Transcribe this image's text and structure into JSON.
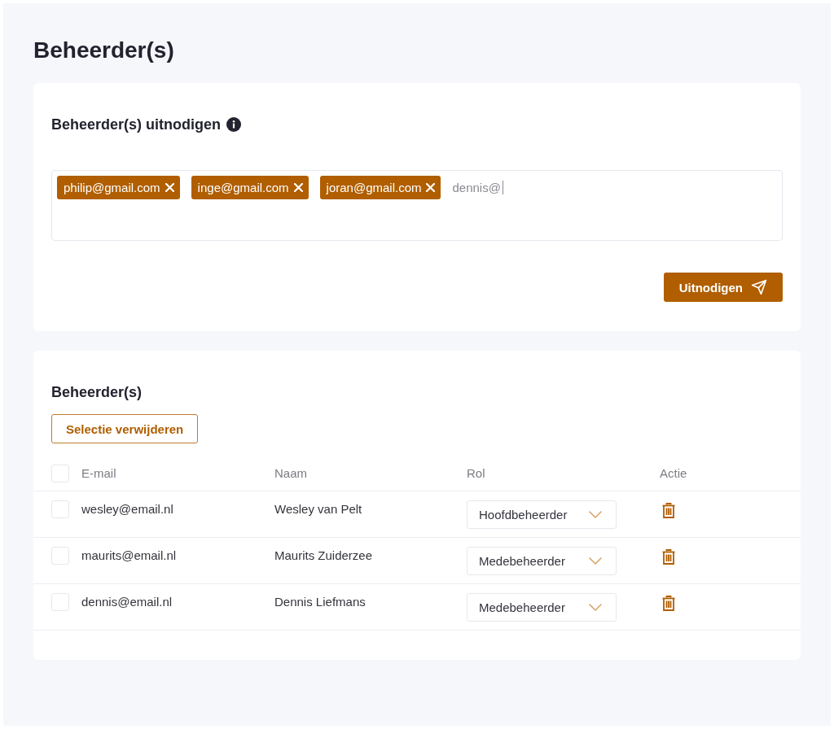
{
  "page": {
    "title": "Beheerder(s)"
  },
  "invite": {
    "title": "Beheerder(s) uitnodigen",
    "tags": [
      {
        "label": "philip@gmail.com"
      },
      {
        "label": "inge@gmail.com"
      },
      {
        "label": "joran@gmail.com"
      }
    ],
    "input": {
      "value": "dennis@",
      "focused": true
    },
    "button": "Uitnodigen"
  },
  "admins": {
    "title": "Beheerder(s)",
    "delete_selection_button": "Selectie verwijderen",
    "select_all": {
      "checked": false
    },
    "columns": [
      "E-mail",
      "Naam",
      "Rol",
      "Actie"
    ],
    "rows": [
      {
        "email": "wesley@email.nl",
        "name": "Wesley van Pelt",
        "role": "Hoofdbeheerder",
        "checked": false
      },
      {
        "email": "maurits@email.nl",
        "name": "Maurits Zuiderzee",
        "role": "Medebeheerder",
        "checked": false
      },
      {
        "email": "dennis@email.nl",
        "name": "Dennis Liefmans",
        "role": "Medebeheerder",
        "checked": false
      }
    ]
  }
}
